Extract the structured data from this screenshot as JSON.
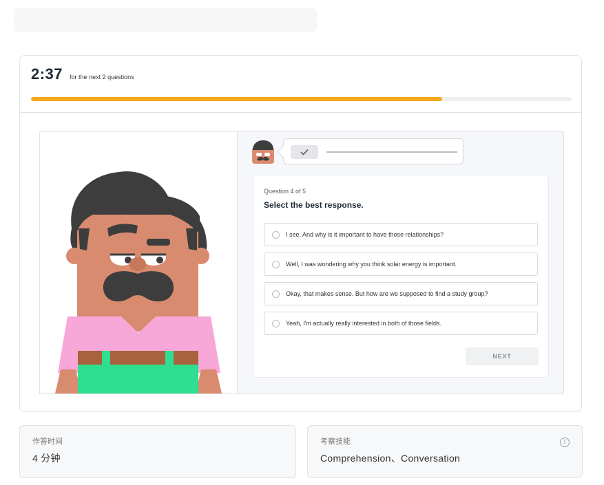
{
  "timer": {
    "time": "2:37",
    "subtitle": "for the next 2 questions",
    "progress_fraction": 0.76
  },
  "question": {
    "counter": "Question 4 of 5",
    "prompt": "Select the best response.",
    "options": [
      "I see. And why is it important to have those relationships?",
      "Well, I was wondering why you think solar energy is important.",
      "Okay, that makes sense. But how are we supposed to find a study group?",
      "Yeah, I'm actually really interested in both of those fields."
    ],
    "next_label": "NEXT"
  },
  "info": {
    "time_label": "作答时间",
    "time_value": "4 分钟",
    "skills_label": "考察技能",
    "skills_value": "Comprehension、Conversation"
  },
  "colors": {
    "progress": "#f7a81c",
    "character_skin": "#d98b6f",
    "character_hair": "#3d3d3d",
    "character_shirt": "#f7a8d8",
    "character_overalls": "#2ddf8e",
    "character_belt": "#a8623e"
  },
  "icons": {
    "bubble": "check-icon",
    "info": "info-icon"
  }
}
